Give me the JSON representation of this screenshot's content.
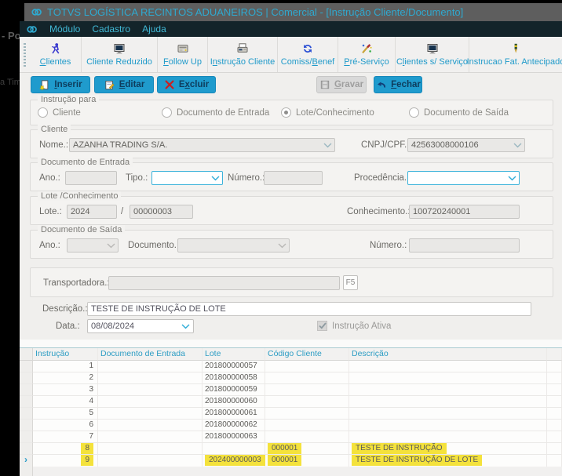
{
  "colors": {
    "accent": "#1f9bcd",
    "title_text": "#2fa9cf",
    "toolbar_label": "#1f9aca",
    "highlight": "#f4e23c",
    "grid_header_text": "#2d9dc4"
  },
  "desktop": {
    "fragment1": "- Po",
    "fragment2": "a Time"
  },
  "titlebar": {
    "title": "TOTVS LOGÍSTICA RECINTOS ADUANEIROS | Comercial - [Instrução Cliente/Documento]"
  },
  "menubar": {
    "items": [
      {
        "label": "Módulo"
      },
      {
        "label": "Cadastro"
      },
      {
        "label": "Ajuda"
      }
    ]
  },
  "toolbar": {
    "items": [
      {
        "label": "Clientes",
        "underline": "C",
        "icon": "person-icon"
      },
      {
        "label": "Cliente Reduzido",
        "underline": "",
        "icon": "monitor-icon"
      },
      {
        "label": "Follow Up",
        "underline": "F",
        "icon": "drive-icon"
      },
      {
        "label": "Instrução Cliente",
        "underline": "n",
        "icon": "printer-icon"
      },
      {
        "label": "Comiss/Benef",
        "underline": "B",
        "icon": "refresh-icon"
      },
      {
        "label": "Pré-Serviço",
        "underline": "P",
        "icon": "brush-icon"
      },
      {
        "label": "Clientes s/ Serviço",
        "underline": "l",
        "icon": "monitor-icon"
      },
      {
        "label": "Instrucao Fat. Antecipado",
        "underline": "",
        "icon": "pen-icon"
      }
    ]
  },
  "actions": [
    {
      "label": "Inserir",
      "underline": "I",
      "icon": "new-doc-icon",
      "enabled": true
    },
    {
      "label": "Editar",
      "underline": "E",
      "icon": "edit-icon",
      "enabled": true
    },
    {
      "label": "Excluir",
      "underline": "x",
      "icon": "delete-icon",
      "enabled": true
    },
    {
      "label": "Gravar",
      "underline": "G",
      "icon": "save-icon",
      "enabled": false
    },
    {
      "label": "Fechar",
      "underline": "F",
      "icon": "undo-icon",
      "enabled": true
    }
  ],
  "form": {
    "instrucao_para": {
      "label": "Instrução para",
      "options": [
        {
          "label": "Cliente",
          "selected": false
        },
        {
          "label": "Documento de Entrada",
          "selected": false
        },
        {
          "label": "Lote/Conhecimento",
          "selected": true
        },
        {
          "label": "Documento de Saída",
          "selected": false
        }
      ]
    },
    "cliente": {
      "label": "Cliente",
      "nome_label": "Nome.:",
      "nome_value": "AZANHA TRADING S/A.",
      "cnpj_label": "CNPJ/CPF.:",
      "cnpj_value": "42563008000106"
    },
    "documento_entrada": {
      "label": "Documento de Entrada",
      "ano_label": "Ano.:",
      "ano_value": "",
      "tipo_label": "Tipo.:",
      "tipo_value": "",
      "numero_label": "Número.:",
      "numero_value": "",
      "procedencia_label": "Procedência.:",
      "procedencia_value": ""
    },
    "lote_conhecimento": {
      "label": "Lote /Conhecimento",
      "lote_label": "Lote.:",
      "lote_ano": "2024",
      "separator": "/",
      "lote_numero": "00000003",
      "conhecimento_label": "Conhecimento.:",
      "conhecimento_value": "100720240001"
    },
    "documento_saida": {
      "label": "Documento de Saída",
      "ano_label": "Ano.:",
      "ano_value": "",
      "documento_label": "Documento.:",
      "documento_value": "",
      "numero_label": "Número.:",
      "numero_value": ""
    },
    "transportadora": {
      "label": "Transportadora.:",
      "value": "",
      "f5_label": "F5"
    },
    "descricao": {
      "label": "Descrição.:",
      "value": "TESTE DE INSTRUÇÃO DE LOTE"
    },
    "data": {
      "label": "Data.:",
      "value": "08/08/2024"
    },
    "instrucao_ativa": {
      "label": "Instrução Ativa",
      "checked": true
    }
  },
  "grid": {
    "columns": [
      "Instrução",
      "Documento de Entrada",
      "Lote",
      "Código Cliente",
      "Descrição"
    ],
    "rows": [
      {
        "instrucao": "1",
        "doc_entrada": "",
        "lote": "201800000057",
        "codigo": "",
        "descricao": "",
        "hl": [],
        "current": false
      },
      {
        "instrucao": "2",
        "doc_entrada": "",
        "lote": "201800000058",
        "codigo": "",
        "descricao": "",
        "hl": [],
        "current": false
      },
      {
        "instrucao": "3",
        "doc_entrada": "",
        "lote": "201800000059",
        "codigo": "",
        "descricao": "",
        "hl": [],
        "current": false
      },
      {
        "instrucao": "4",
        "doc_entrada": "",
        "lote": "201800000060",
        "codigo": "",
        "descricao": "",
        "hl": [],
        "current": false
      },
      {
        "instrucao": "5",
        "doc_entrada": "",
        "lote": "201800000061",
        "codigo": "",
        "descricao": "",
        "hl": [],
        "current": false
      },
      {
        "instrucao": "6",
        "doc_entrada": "",
        "lote": "201800000062",
        "codigo": "",
        "descricao": "",
        "hl": [],
        "current": false
      },
      {
        "instrucao": "7",
        "doc_entrada": "",
        "lote": "201800000063",
        "codigo": "",
        "descricao": "",
        "hl": [],
        "current": false
      },
      {
        "instrucao": "8",
        "doc_entrada": "",
        "lote": "",
        "codigo": "000001",
        "descricao": "TESTE DE INSTRUÇÃO",
        "hl": [
          "instrucao",
          "codigo",
          "descricao"
        ],
        "current": false
      },
      {
        "instrucao": "9",
        "doc_entrada": "",
        "lote": "202400000003",
        "codigo": "000001",
        "descricao": "TESTE DE INSTRUÇÃO DE LOTE",
        "hl": [
          "instrucao",
          "lote",
          "codigo",
          "descricao"
        ],
        "current": true
      }
    ]
  }
}
